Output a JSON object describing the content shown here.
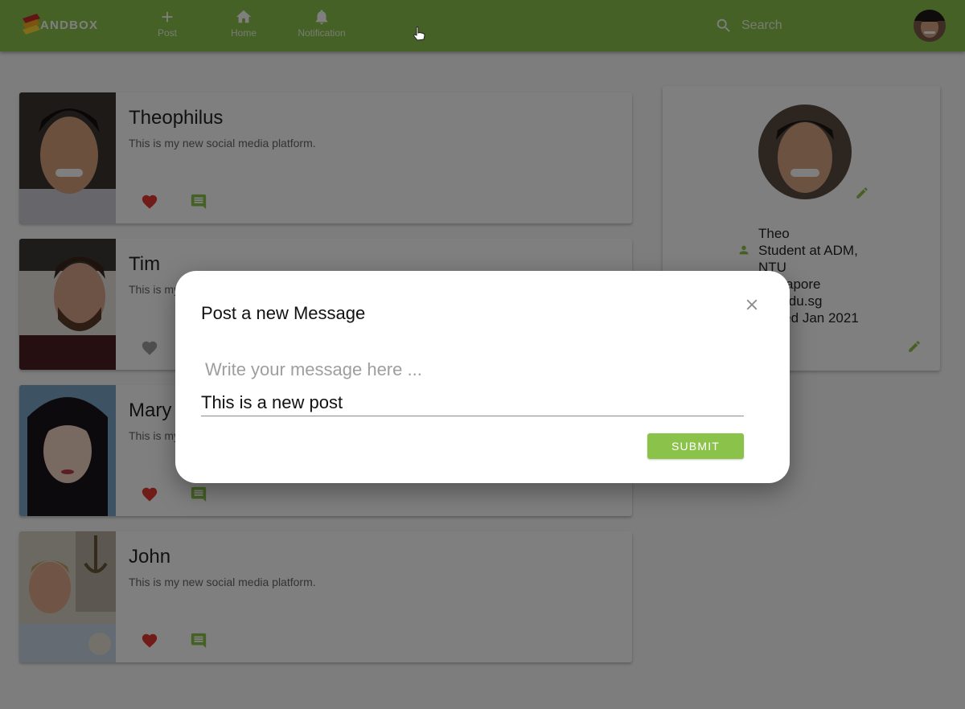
{
  "app": {
    "logo_text": "ANDBOX"
  },
  "nav": {
    "post_label": "Post",
    "home_label": "Home",
    "notification_label": "Notification"
  },
  "search": {
    "placeholder": "Search",
    "value": ""
  },
  "posts": [
    {
      "name": "Theophilus",
      "body": "This is my new social media platform.",
      "liked": true
    },
    {
      "name": "Tim",
      "body": "This is my new social media platform.",
      "liked": false
    },
    {
      "name": "Mary",
      "body": "This is my new social media platform.",
      "liked": true
    },
    {
      "name": "John",
      "body": "This is my new social media platform.",
      "liked": true
    }
  ],
  "profile": {
    "name": "Theo",
    "bio": "Student at ADM, NTU",
    "location": "Singapore",
    "website": "ntu.edu.sg",
    "joined": "Joined Jan 2021"
  },
  "dialog": {
    "title": "Post a new Message",
    "field_label": "Write your message here ...",
    "field_value": "This is a new post",
    "submit_label": "SUBMIT"
  },
  "colors": {
    "primary": "#8bc34a",
    "like_active": "#e53935",
    "like_inactive": "#9e9e9e"
  }
}
